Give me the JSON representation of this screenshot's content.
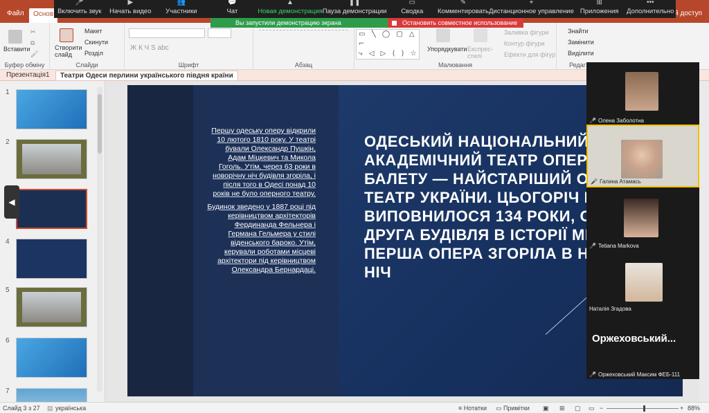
{
  "ppt": {
    "tabs": {
      "file": "Файл",
      "home": "Основ"
    },
    "share": "загальний доступ",
    "ribbon": {
      "paste": "Вставити",
      "create_slide": "Створити слайд",
      "layout": "Макет",
      "reset": "Скинути",
      "section": "Розділ",
      "arrange": "Упорядкувати",
      "express_styles": "Експрес-стилі",
      "fill": "Заливка фігури",
      "outline": "Контур фігури",
      "effects": "Ефекти для фігур",
      "find": "Знайти",
      "replace": "Замінити",
      "select": "Виділити",
      "groups": {
        "clipboard": "Буфер обміну",
        "slides": "Слайди",
        "font": "Шрифт",
        "paragraph": "Абзац",
        "drawing": "Малювання",
        "editing": "Редаг"
      },
      "font_buttons": "Ж  К  Ч  S  abc",
      "shape_rows": [
        "▭ ╲ ◯ ▢ △ ⌐",
        "⤷ ◁ ▷ ⟨ ⟩ ☆",
        "↷ ∿ { } ☆ ▭"
      ]
    },
    "doc_tabs": {
      "tab1": "Презентація1",
      "tab2": "Театри Одеси перлини українського півдня країни"
    },
    "thumbnails": [
      {
        "num": "1"
      },
      {
        "num": "2"
      },
      {
        "num": "3"
      },
      {
        "num": "4"
      },
      {
        "num": "5"
      },
      {
        "num": "6"
      },
      {
        "num": "7"
      }
    ],
    "slide": {
      "left_p1": "Першу одеську оперу відкрили 10 лютого 1810 року. У театрі бували Олександр Пушкін, Адам Міцкевич та Микола Гоголь. Утім, через 63 роки в новорічну ніч будівля згоріла, і після того в Одесі понад 10 років не було оперного театру.",
      "left_p2": "Будинок зведено у 1887 році під керівництвом архітекторів Фердинанда Фельнера і Германа Гельмера у стилі віденського бароко. Утім, керували роботами місцеві архітектори під керівництвом Олександра Бернардаці.",
      "title": "ОДЕСЬКИЙ НАЦІОНАЛЬНИЙ АКАДЕМІЧНИЙ ТЕАТР ОПЕРИ ТА БАЛЕТУ — НАЙСТАРІШИЙ ОПЕРНИЙ ТЕАТР УКРАЇНИ. ЦЬОГОРІЧ ЙОМУ ВИПОВНИЛОСЯ 134 РОКИ, ОДНАК ЦЕ ДРУГА БУДІВЛЯ В ІСТОРІЇ МІСТА. ПЕРША ОПЕРА ЗГОРІЛА В НОВОРІЧНУ НІЧ"
    },
    "status": {
      "slide_info": "Слайд 3 з 27",
      "language": "українська",
      "notes": "Нотатки",
      "comments": "Примітки",
      "zoom": "88%"
    }
  },
  "zoom": {
    "items": [
      {
        "icon": "🎤",
        "label": "Включить звук"
      },
      {
        "icon": "▶",
        "label": "Начать видео"
      },
      {
        "icon": "👥",
        "label": "Участники"
      },
      {
        "icon": "💬",
        "label": "Чат"
      },
      {
        "icon": "▲",
        "label": "Новая демонстрация"
      },
      {
        "icon": "❚❚",
        "label": "Пауза демонстрации"
      },
      {
        "icon": "▭",
        "label": "Сводка"
      },
      {
        "icon": "✎",
        "label": "Комментировать"
      },
      {
        "icon": "⌖",
        "label": "Дистанционное управление"
      },
      {
        "icon": "⊞",
        "label": "Приложения"
      },
      {
        "icon": "•••",
        "label": "Дополнительно"
      }
    ],
    "sharing_notice": "Вы запустили демонстрацию экрана",
    "stop_sharing": "Остановить совместное использование",
    "participants": [
      {
        "name": "Олена Заболотна"
      },
      {
        "name": "Галина Атамась"
      },
      {
        "name": "Tetiana Markova"
      },
      {
        "name": "Наталія Згадова"
      },
      {
        "name": "Оржеховський Максим ФЕБ-111",
        "display": "Оржеховський..."
      }
    ],
    "colors": {
      "active": "#3dd36b",
      "stop": "#d83b3b",
      "brand": "#b7472a"
    }
  }
}
